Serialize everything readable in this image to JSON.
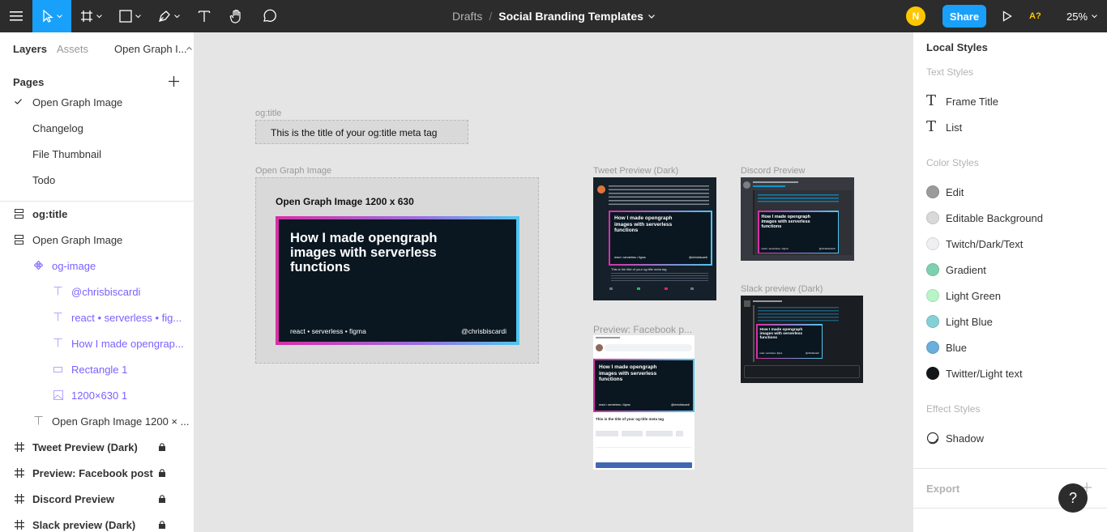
{
  "toolbar": {
    "tools": [
      "menu-icon",
      "move-tool",
      "frame-tool",
      "shape-tool",
      "pen-tool",
      "text-tool",
      "hand-tool",
      "comment-tool"
    ],
    "breadcrumb": {
      "drafts": "Drafts",
      "separator": "/",
      "file": "Social Branding Templates"
    },
    "avatar_initial": "N",
    "share_label": "Share",
    "access_label": "A?",
    "zoom": "25%",
    "accent_color": "#18a0fb",
    "avatar_color": "#ffc700"
  },
  "left_panel": {
    "tabs": {
      "layers": "Layers",
      "assets": "Assets",
      "page": "Open Graph I..."
    },
    "pages_title": "Pages",
    "pages": [
      "Open Graph Image",
      "Changelog",
      "File Thumbnail",
      "Todo"
    ],
    "selected_page": "Open Graph Image",
    "layers": [
      {
        "label": "og:title",
        "icon": "frame-icon"
      },
      {
        "label": "Open Graph Image",
        "icon": "frame-icon"
      },
      {
        "label": "og-image",
        "icon": "component-icon"
      },
      {
        "label": "@chrisbiscardi",
        "icon": "text-icon"
      },
      {
        "label": "react • serverless • fig...",
        "icon": "text-icon"
      },
      {
        "label": "How I made opengrap...",
        "icon": "text-icon"
      },
      {
        "label": "Rectangle 1",
        "icon": "rectangle-icon"
      },
      {
        "label": "1200×630 1",
        "icon": "image-icon"
      },
      {
        "label": "Open Graph Image 1200 × ...",
        "icon": "text-icon"
      },
      {
        "label": "Tweet Preview (Dark)",
        "icon": "hash-icon",
        "locked": true
      },
      {
        "label": "Preview: Facebook post",
        "icon": "hash-icon",
        "locked": true
      },
      {
        "label": "Discord Preview",
        "icon": "hash-icon",
        "locked": true
      },
      {
        "label": "Slack preview (Dark)",
        "icon": "hash-icon",
        "locked": true
      }
    ]
  },
  "canvas": {
    "og_title_frame": {
      "label": "og:title",
      "text": "This is the title of your og:title meta tag"
    },
    "og_image_frame": {
      "label": "Open Graph Image",
      "heading": "Open Graph Image 1200 x 630",
      "card_title": "How I made  opengraph images with serverless functions",
      "card_tags": "react • serverless • figma",
      "card_handle": "@chrisbiscardi"
    },
    "tweet_frame": {
      "label": "Tweet Preview (Dark)"
    },
    "discord_frame": {
      "label": "Discord Preview"
    },
    "facebook_frame": {
      "label": "Preview: Facebook p..."
    },
    "slack_frame": {
      "label": "Slack preview (Dark)"
    },
    "mini_card_title": "How I made  opengraph images with serverless functions",
    "mini_card_tags": "react • serverless • figma",
    "mini_card_handle": "@chrisbiscardi",
    "tweet_title_line": "This is the title of your og:title meta tag",
    "facebook_title_line": "This is the title of your og:title meta tag"
  },
  "right_panel": {
    "title": "Local Styles",
    "text_styles_label": "Text Styles",
    "text_styles": [
      "Frame Title",
      "List"
    ],
    "color_styles_label": "Color Styles",
    "color_styles": [
      {
        "name": "Edit",
        "color": "#9b9b9b"
      },
      {
        "name": "Editable Background",
        "color": "#d9d9d9"
      },
      {
        "name": "Twitch/Dark/Text",
        "color": "#efeff1"
      },
      {
        "name": "Gradient",
        "color": "#7fd0b0"
      },
      {
        "name": "Light Green",
        "color": "#b7f5c8"
      },
      {
        "name": "Light Blue",
        "color": "#84d0d6"
      },
      {
        "name": "Blue",
        "color": "#6aaedb"
      },
      {
        "name": "Twitter/Light text",
        "color": "#14171a"
      }
    ],
    "effect_styles_label": "Effect Styles",
    "effect_styles": [
      "Shadow"
    ],
    "export_label": "Export"
  },
  "help_label": "?"
}
